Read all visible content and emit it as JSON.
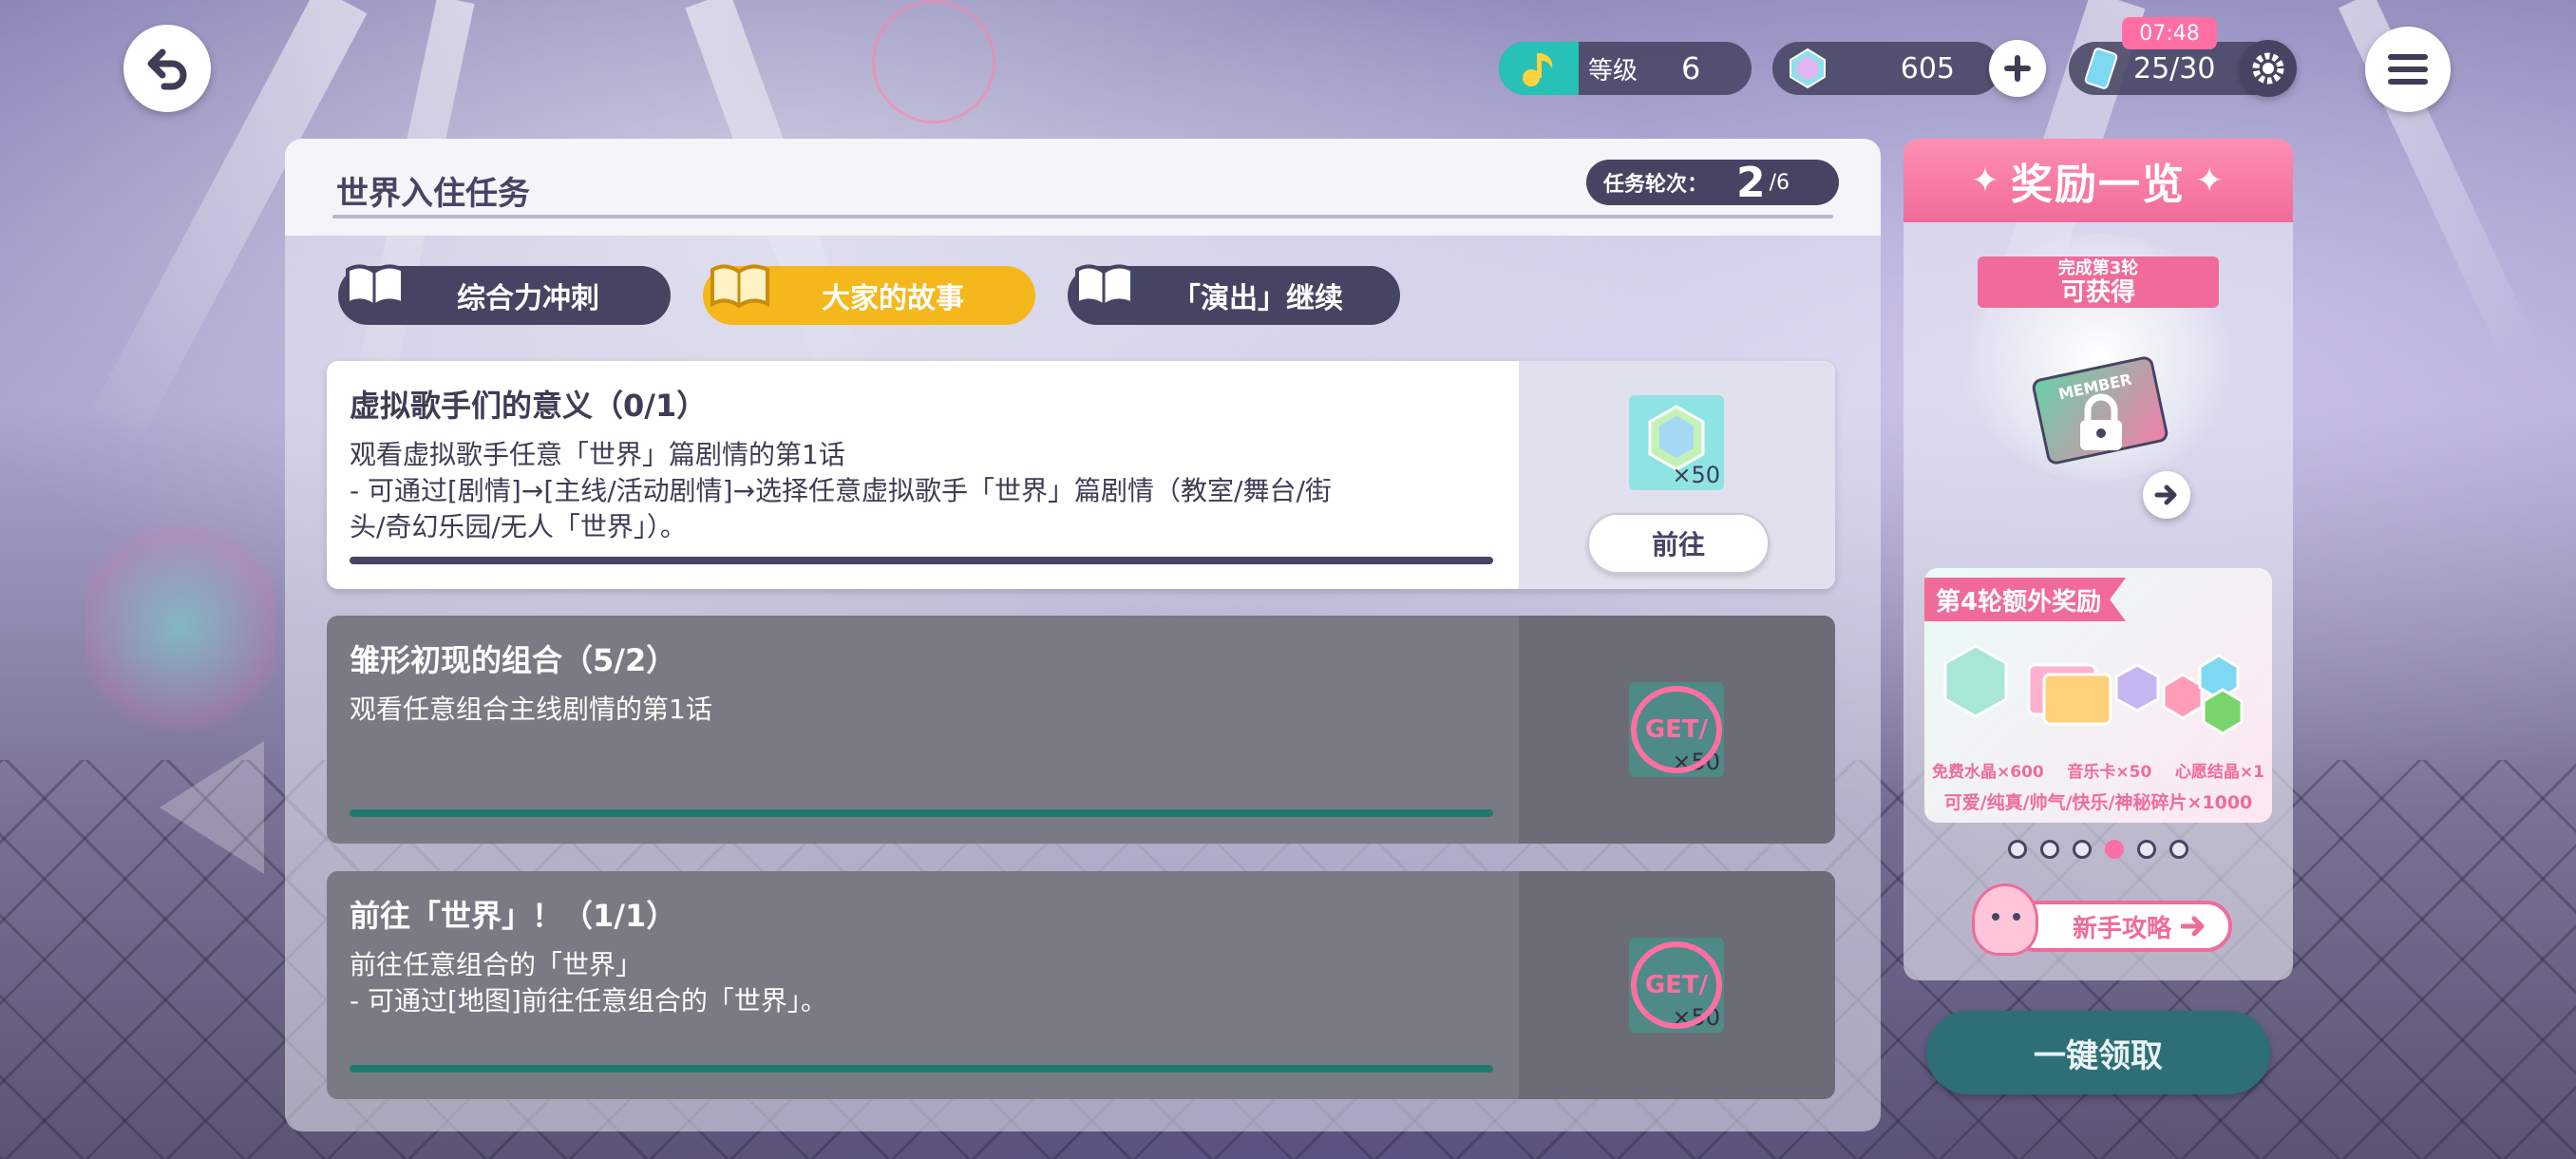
{
  "top_bar": {
    "level_label": "等级",
    "level_value": "6",
    "crystal_count": "605",
    "energy_time": "07:48",
    "energy_value": "25/30"
  },
  "panel": {
    "title": "世界入住任务",
    "round_label": "任务轮次：",
    "round_current": "2",
    "round_total": "/6"
  },
  "tabs": [
    {
      "label": "综合力冲刺",
      "active": false
    },
    {
      "label": "大家的故事",
      "active": true
    },
    {
      "label": "「演出」继续",
      "active": false
    }
  ],
  "tasks": [
    {
      "title": "虚拟歌手们的意义（0/1）",
      "desc_line1": "观看虚拟歌手任意「世界」篇剧情的第1话",
      "desc_line2": "- 可通过[剧情]→[主线/活动剧情]→选择任意虚拟歌手「世界」篇剧情（教室/舞台/街",
      "desc_line3": "头/奇幻乐园/无人「世界」）。",
      "reward_qty": "×50",
      "action_label": "前往",
      "progress": 0
    },
    {
      "title": "雏形初现的组合（5/2）",
      "desc_line1": "观看任意组合主线剧情的第1话",
      "reward_qty": "×50",
      "stamp": "GET/",
      "progress": 1
    },
    {
      "title": "前往「世界」！（1/1）",
      "desc_line1": "前往任意组合的「世界」",
      "desc_line2": "- 可通过[地图]前往任意组合的「世界」。",
      "reward_qty": "×50",
      "stamp": "GET/",
      "progress": 1
    }
  ],
  "rewards": {
    "header": "奖励一览",
    "ribbon_top": "完成第3轮",
    "ribbon_bottom": "可获得",
    "card_text": "MEMBER",
    "bonus_title": "第4轮额外奖励",
    "bonus_line1_a": "免费水晶×600",
    "bonus_line1_b": "音乐卡×50",
    "bonus_line1_c": "心愿结晶×1",
    "bonus_line2": "可爱/纯真/帅气/快乐/神秘碎片×1000",
    "page_dots": 6,
    "active_dot": 4,
    "guide_label": "新手攻略",
    "claim_all": "一键领取"
  },
  "colors": {
    "accent_pink": "#f06b9a",
    "tab_active": "#f4b81c",
    "tab_inactive": "#454563",
    "progress_done": "#1f7a6e",
    "claim_button": "#2e6f77"
  }
}
